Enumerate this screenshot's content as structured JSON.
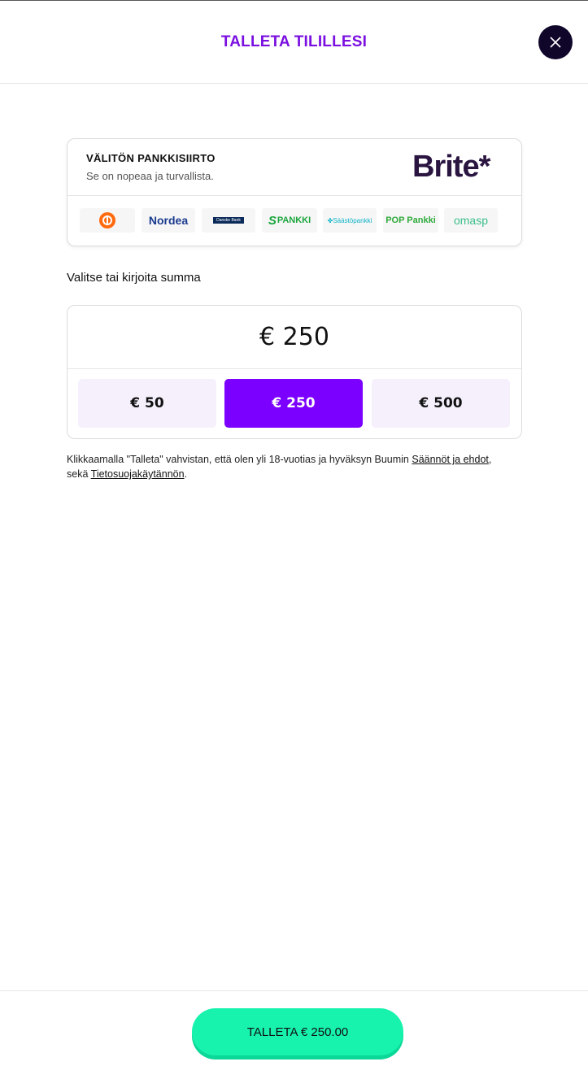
{
  "header": {
    "title": "TALLETA TILILLESI"
  },
  "bank_transfer": {
    "title": "VÄLITÖN PANKKISIIRTO",
    "subtitle": "Se on nopeaa ja turvallista.",
    "provider_logo": "Brite*",
    "banks": [
      {
        "name": "OP",
        "label": "",
        "color": "#ff6a10"
      },
      {
        "name": "Nordea",
        "label": "Nordea",
        "color": "#1a3a8f"
      },
      {
        "name": "Danske Bank",
        "label": "Danske Bank",
        "color": "#0a2a5a"
      },
      {
        "name": "S-Pankki",
        "label": "PANKKI",
        "color": "#1aa53b"
      },
      {
        "name": "Säästöpankki",
        "label": "Säästöpankki",
        "color": "#10b4c8"
      },
      {
        "name": "POP Pankki",
        "label": "POP Pankki",
        "color": "#2eaa3a"
      },
      {
        "name": "OmaSP",
        "label": "omasp",
        "color": "#3bbf8a"
      }
    ]
  },
  "amount": {
    "label": "Valitse tai kirjoita summa",
    "value": "€ 250",
    "presets": [
      "€ 50",
      "€ 250",
      "€ 500"
    ],
    "selected_index": 1
  },
  "terms": {
    "text_before": "Klikkaamalla \"Talleta\" vahvistan, että olen yli 18-vuotias ja hyväksyn Buumin ",
    "link_terms": "Säännöt ja ehdot",
    "text_middle": ", sekä ",
    "link_privacy": "Tietosuojakäytännön",
    "text_after": "."
  },
  "footer": {
    "deposit_button": "TALLETA € 250.00"
  },
  "colors": {
    "accent": "#7b00ff",
    "title": "#7a0fe0",
    "deposit": "#17f2ad",
    "close_bg": "#10062a"
  }
}
